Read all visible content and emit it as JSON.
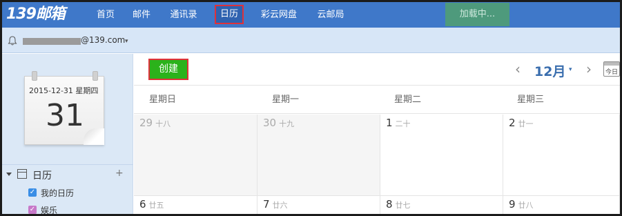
{
  "app": {
    "logo": "139邮箱",
    "nav": [
      "首页",
      "邮件",
      "通讯录",
      "日历",
      "彩云网盘",
      "云邮局"
    ],
    "active_nav": "日历",
    "loading": "加载中..."
  },
  "account": {
    "email_suffix": "@139.com",
    "caret": "▾"
  },
  "sidebar": {
    "date_line": "2015-12-31 星期四",
    "day": "31",
    "calendar_header": "日历",
    "plus": "+",
    "calendars": [
      {
        "label": "我的日历",
        "color": "#3a8ee6",
        "checked": "✓"
      },
      {
        "label": "娱乐",
        "color": "#c779c9",
        "checked": "✓"
      }
    ]
  },
  "toolbar": {
    "create_label": "创建",
    "prev": "‹",
    "month": "12月",
    "month_caret": "▾",
    "next": "›",
    "today_icon_text": "今日"
  },
  "weekdays": [
    "星期日",
    "星期一",
    "星期二",
    "星期三"
  ],
  "weeks": [
    [
      {
        "day": "29",
        "lunar": "十八",
        "other_month": true
      },
      {
        "day": "30",
        "lunar": "十九",
        "other_month": true
      },
      {
        "day": "1",
        "lunar": "二十",
        "other_month": false
      },
      {
        "day": "2",
        "lunar": "廿一",
        "other_month": false
      }
    ],
    [
      {
        "day": "6",
        "lunar": "廿五",
        "other_month": false
      },
      {
        "day": "7",
        "lunar": "廿六",
        "other_month": false
      },
      {
        "day": "8",
        "lunar": "廿七",
        "other_month": false
      },
      {
        "day": "9",
        "lunar": "廿八",
        "other_month": false
      }
    ]
  ]
}
